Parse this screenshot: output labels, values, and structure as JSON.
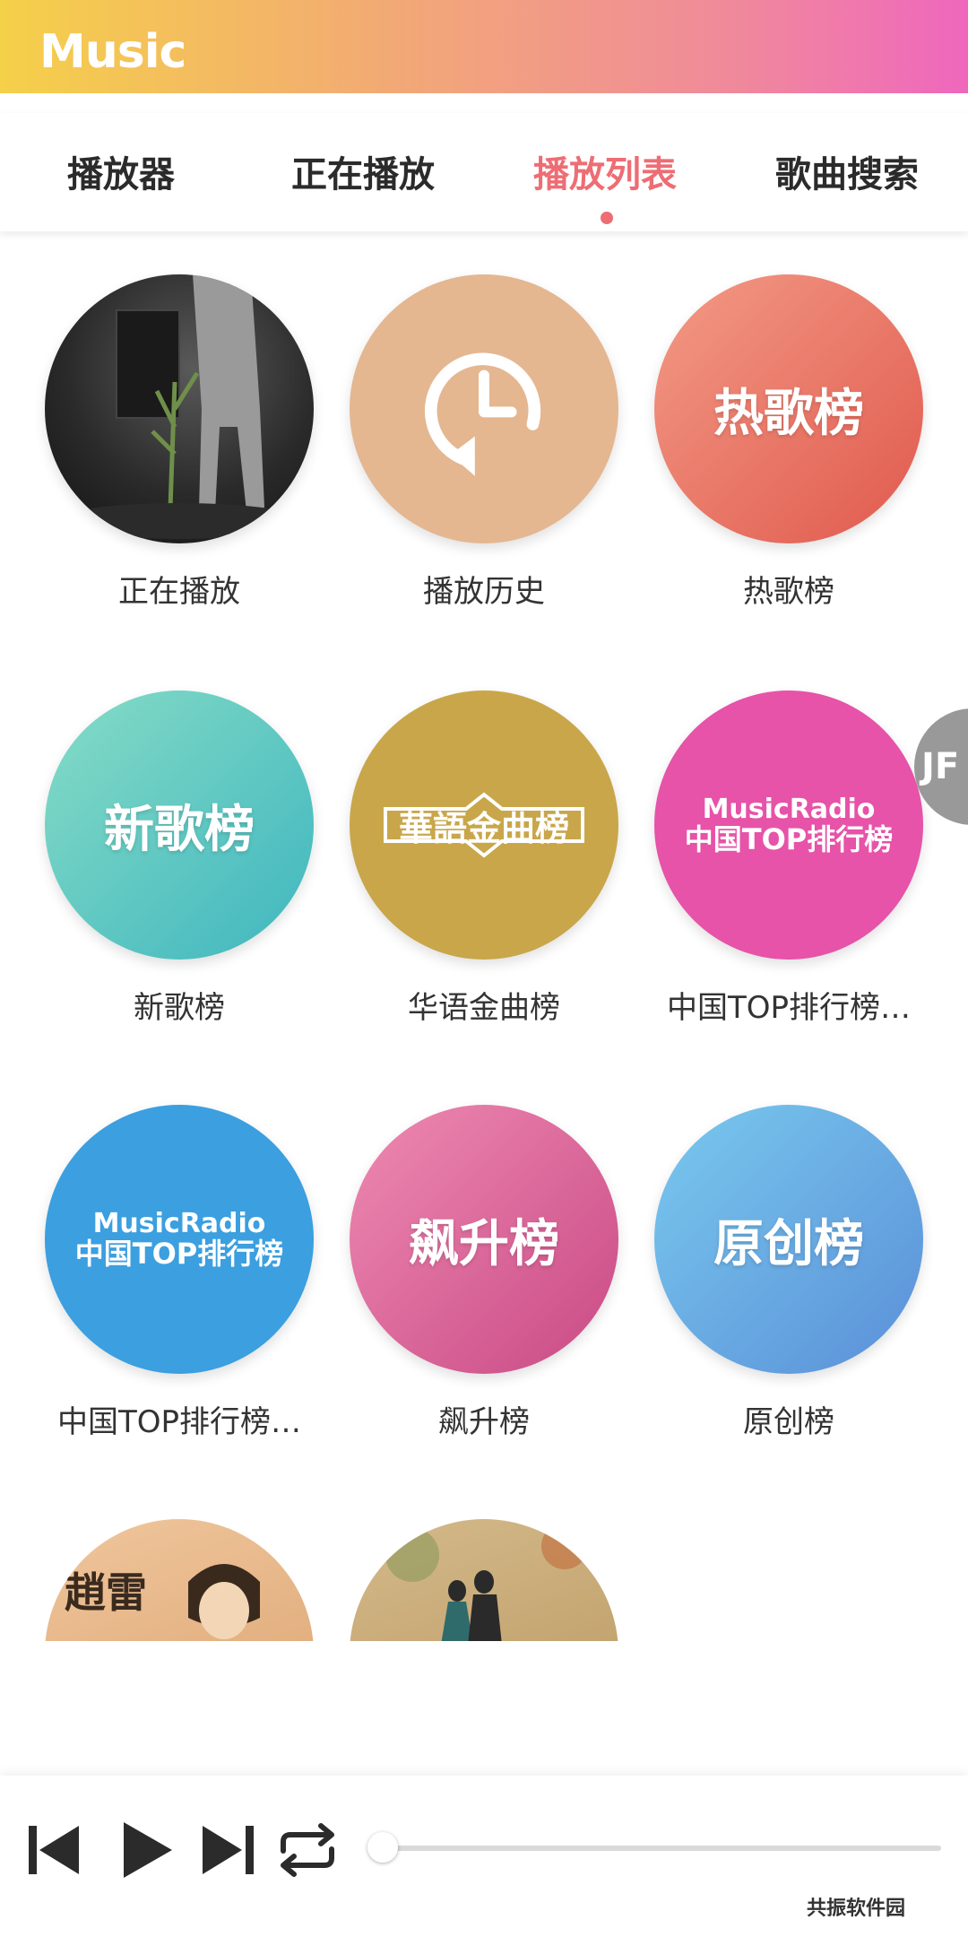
{
  "header": {
    "title": "Music"
  },
  "tabs": [
    {
      "label": "播放器"
    },
    {
      "label": "正在播放"
    },
    {
      "label": "播放列表"
    },
    {
      "label": "歌曲搜索"
    }
  ],
  "active_tab_index": 2,
  "playlists": [
    {
      "label": "正在播放",
      "cover": "album-photo"
    },
    {
      "label": "播放历史",
      "cover": "history-clock-icon"
    },
    {
      "label": "热歌榜",
      "cover_text": "热歌榜"
    },
    {
      "label": "新歌榜",
      "cover_text": "新歌榜"
    },
    {
      "label": "华语金曲榜",
      "cover_text": "華語金曲榜"
    },
    {
      "label": "中国TOP排行榜…",
      "cover_brand": "MusicRadio",
      "cover_sub": "中国TOP排行榜"
    },
    {
      "label": "中国TOP排行榜…",
      "cover_brand": "MusicRadio",
      "cover_sub": "中国TOP排行榜"
    },
    {
      "label": "飙升榜",
      "cover_text": "飙升榜"
    },
    {
      "label": "原创榜",
      "cover_text": "原创榜"
    },
    {
      "label": "",
      "cover": "artist-photo",
      "cover_text": "趙雷"
    },
    {
      "label": "",
      "cover": "couple-illustration"
    }
  ],
  "floating_button": {
    "label": "JF"
  },
  "player": {
    "progress": 0.0
  },
  "watermark": {
    "text": "共振软件园"
  },
  "colors": {
    "accent": "#ee6d74",
    "hot": "#e86a5e",
    "new": "#5cc7c0",
    "gold": "#c9a64a",
    "magenta": "#e653a8",
    "blue_top": "#3b9fe0",
    "rising": "#d9568f",
    "original": "#5b9fe0"
  }
}
